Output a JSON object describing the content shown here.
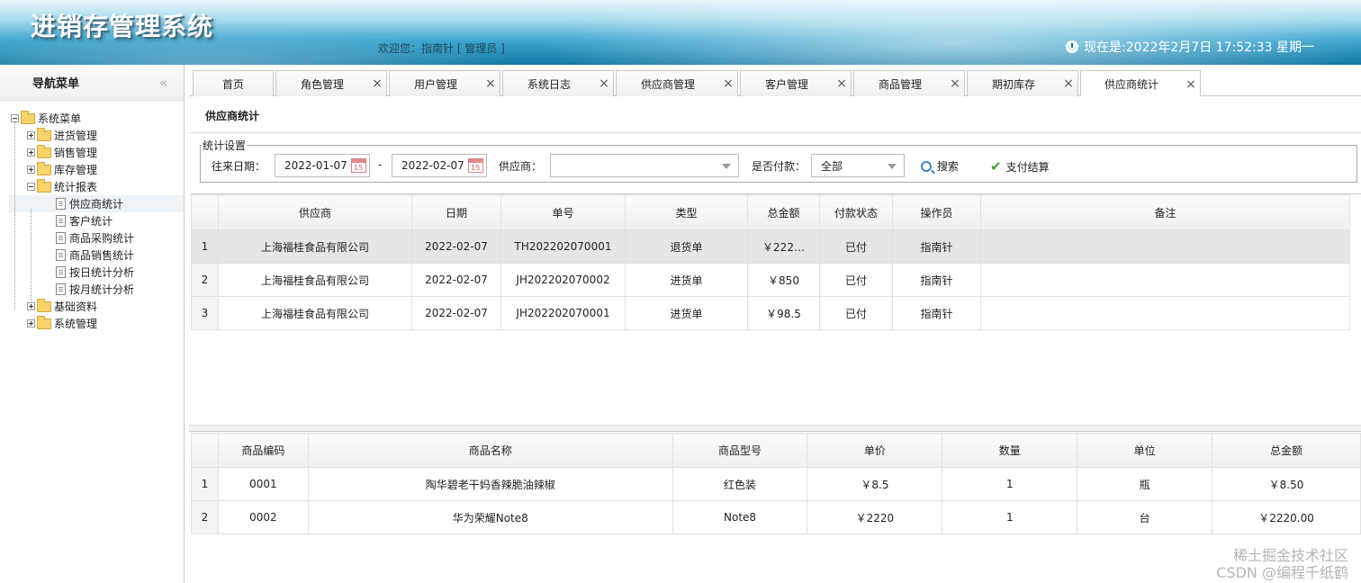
{
  "header": {
    "title": "进销存管理系统",
    "welcome": "欢迎您：指南针 [ 管理员 ]",
    "clock": "现在是:2022年2月7日 17:52:33 星期一"
  },
  "sidebar": {
    "title": "导航菜单",
    "collapse_icon": "«",
    "root": "系统菜单",
    "groups": [
      "进货管理",
      "销售管理",
      "库存管理",
      "统计报表",
      "基础资料",
      "系统管理"
    ],
    "report_items": [
      "供应商统计",
      "客户统计",
      "商品采购统计",
      "商品销售统计",
      "按日统计分析",
      "按月统计分析"
    ]
  },
  "tabs": [
    {
      "label": "首页"
    },
    {
      "label": "角色管理"
    },
    {
      "label": "用户管理"
    },
    {
      "label": "系统日志"
    },
    {
      "label": "供应商管理"
    },
    {
      "label": "客户管理"
    },
    {
      "label": "商品管理"
    },
    {
      "label": "期初库存"
    },
    {
      "label": "供应商统计"
    }
  ],
  "panel": {
    "title": "供应商统计"
  },
  "filters": {
    "legend": "统计设置",
    "date_label": "往来日期：",
    "date_from": "2022-01-07",
    "date_sep": "-",
    "date_to": "2022-02-07",
    "supplier_label": "供应商：",
    "supplier_value": "",
    "paid_label": "是否付款：",
    "paid_value": "全部",
    "search_label": "搜索",
    "pay_label": "支付结算"
  },
  "orders": {
    "columns": [
      "供应商",
      "日期",
      "单号",
      "类型",
      "总金额",
      "付款状态",
      "操作员",
      "备注"
    ],
    "rows": [
      {
        "no": "1",
        "supplier": "上海福桂食品有限公司",
        "date": "2022-02-07",
        "code": "TH202202070001",
        "type": "退货单",
        "amount": "￥222…",
        "status": "已付",
        "operator": "指南针",
        "note": ""
      },
      {
        "no": "2",
        "supplier": "上海福桂食品有限公司",
        "date": "2022-02-07",
        "code": "JH202202070002",
        "type": "进货单",
        "amount": "￥850",
        "status": "已付",
        "operator": "指南针",
        "note": ""
      },
      {
        "no": "3",
        "supplier": "上海福桂食品有限公司",
        "date": "2022-02-07",
        "code": "JH202202070001",
        "type": "进货单",
        "amount": "￥98.5",
        "status": "已付",
        "operator": "指南针",
        "note": ""
      }
    ]
  },
  "items": {
    "columns": [
      "商品编码",
      "商品名称",
      "商品型号",
      "单价",
      "数量",
      "单位",
      "总金额"
    ],
    "rows": [
      {
        "no": "1",
        "code": "0001",
        "name": "陶华碧老干妈香辣脆油辣椒",
        "model": "红色装",
        "price": "￥8.5",
        "qty": "1",
        "unit": "瓶",
        "total": "￥8.50"
      },
      {
        "no": "2",
        "code": "0002",
        "name": "华为荣耀Note8",
        "model": "Note8",
        "price": "￥2220",
        "qty": "1",
        "unit": "台",
        "total": "￥2220.00"
      }
    ]
  },
  "watermark": {
    "line1": "稀土掘金技术社区",
    "line2": "CSDN @编程千纸鹤"
  }
}
